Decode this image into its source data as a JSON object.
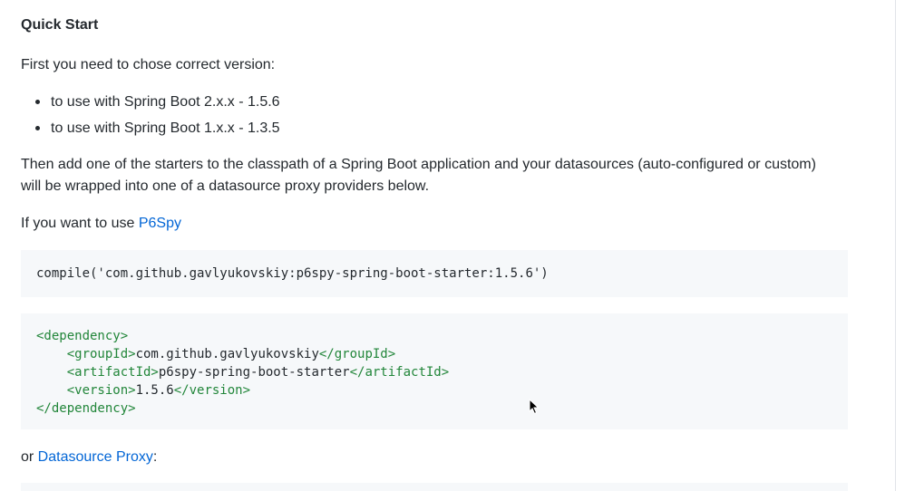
{
  "heading": "Quick Start",
  "intro": "First you need to chose correct version:",
  "bullets": [
    "to use with Spring Boot 2.x.x - 1.5.6",
    "to use with Spring Boot 1.x.x - 1.3.5"
  ],
  "then_text": "Then add one of the starters to the classpath of a Spring Boot application and your datasources (auto-configured or custom) will be wrapped into one of a datasource proxy providers below.",
  "if_want": {
    "prefix": "If you want to use ",
    "link": "P6Spy"
  },
  "gradle_snippet": "compile('com.github.gavlyukovskiy:p6spy-spring-boot-starter:1.5.6')",
  "maven": {
    "dependency_open": "<dependency>",
    "group_open": "<groupId>",
    "group_value": "com.github.gavlyukovskiy",
    "group_close": "</groupId>",
    "artifact_open": "<artifactId>",
    "artifact_value": "p6spy-spring-boot-starter",
    "artifact_close": "</artifactId>",
    "version_open": "<version>",
    "version_value": "1.5.6",
    "version_close": "</version>",
    "dependency_close": "</dependency>"
  },
  "or_line": {
    "prefix": "or ",
    "link": "Datasource Proxy",
    "suffix": ":"
  },
  "icons": {
    "cursor": "mouse-pointer-icon"
  },
  "colors": {
    "link": "#0366d6",
    "xml_tag": "#22863a",
    "code_bg": "#f6f8fa"
  }
}
